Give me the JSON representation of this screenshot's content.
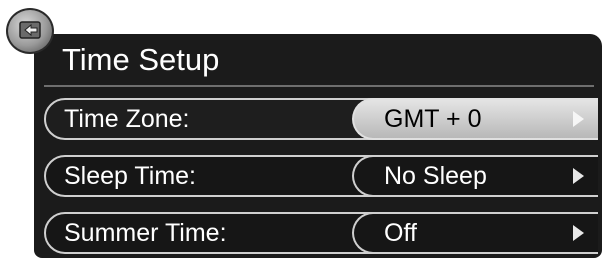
{
  "dialog": {
    "title": "Time Setup",
    "icon": "menu-back-icon"
  },
  "settings": [
    {
      "label": "Time Zone:",
      "value": "GMT + 0",
      "selected": true
    },
    {
      "label": "Sleep Time:",
      "value": "No Sleep",
      "selected": false
    },
    {
      "label": "Summer Time:",
      "value": "Off",
      "selected": false
    }
  ],
  "colors": {
    "panel": "#1b1b1b",
    "selected_value_bg": "#c8c8c8",
    "text": "#ffffff"
  }
}
